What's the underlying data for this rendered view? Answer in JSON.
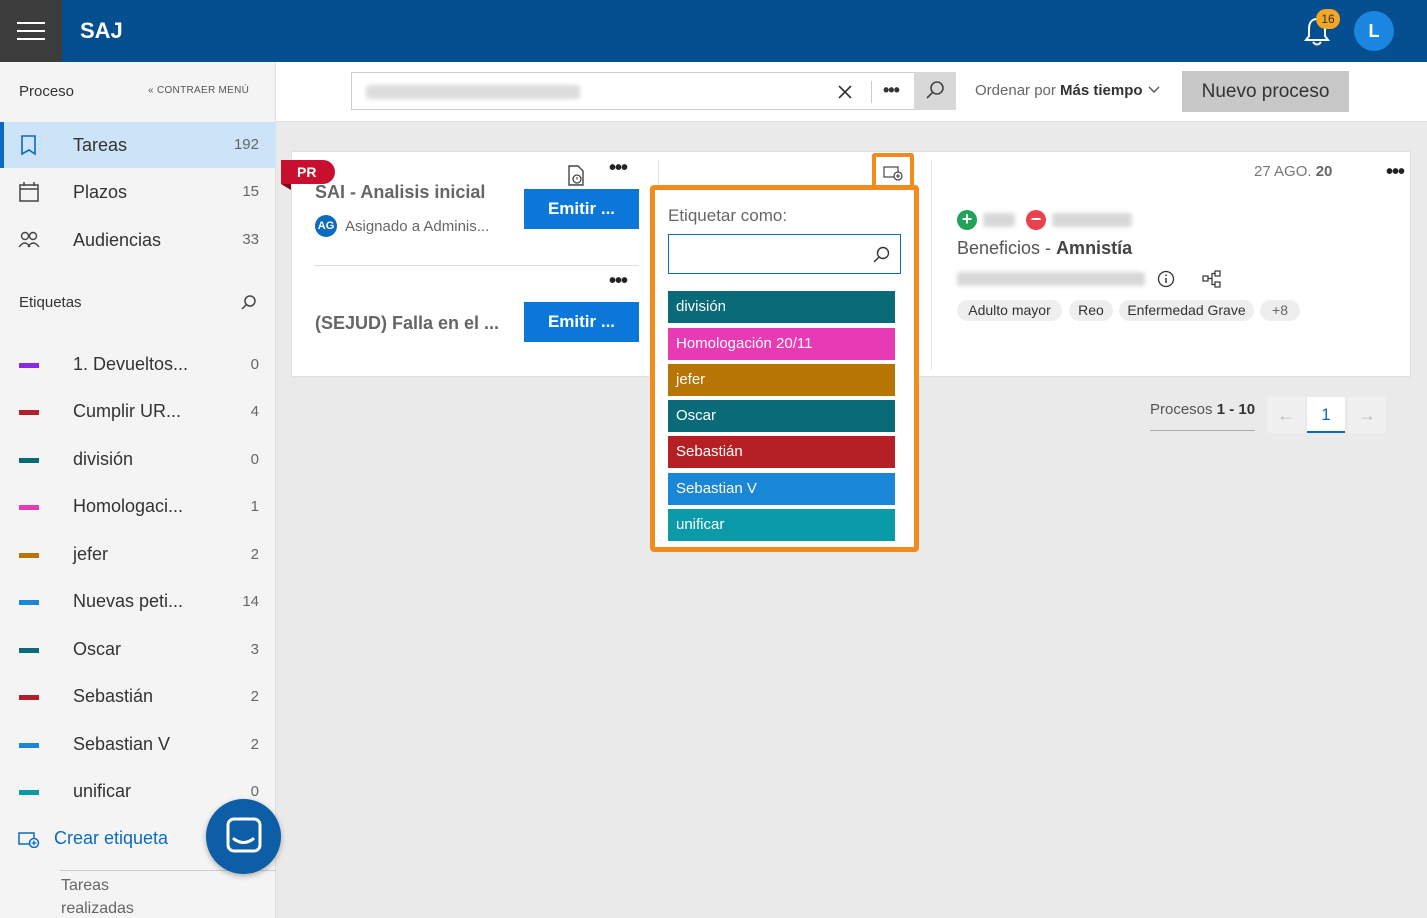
{
  "app": {
    "title": "SAJ",
    "notifications_count": "16",
    "user_initial": "L"
  },
  "sidebar": {
    "section_title": "Proceso",
    "collapse_label": "CONTRAER MENÚ",
    "nav": [
      {
        "label": "Tareas",
        "count": "192",
        "icon": "book-icon"
      },
      {
        "label": "Plazos",
        "count": "15",
        "icon": "calendar-icon"
      },
      {
        "label": "Audiencias",
        "count": "33",
        "icon": "people-icon"
      }
    ],
    "tags_title": "Etiquetas",
    "tags": [
      {
        "label": "1. Devueltos...",
        "count": "0",
        "color": "#8a2be2"
      },
      {
        "label": "Cumplir UR...",
        "count": "4",
        "color": "#b0202a"
      },
      {
        "label": "división",
        "count": "0",
        "color": "#0a6b78"
      },
      {
        "label": "Homologaci...",
        "count": "1",
        "color": "#e83ab5"
      },
      {
        "label": "jefer",
        "count": "2",
        "color": "#b67504"
      },
      {
        "label": "Nuevas peti...",
        "count": "14",
        "color": "#1a86d8"
      },
      {
        "label": "Oscar",
        "count": "3",
        "color": "#0a6b78"
      },
      {
        "label": "Sebastián",
        "count": "2",
        "color": "#b0202a"
      },
      {
        "label": "Sebastian V",
        "count": "2",
        "color": "#1a86d8"
      },
      {
        "label": "unificar",
        "count": "0",
        "color": "#0a9aa8"
      }
    ],
    "create_tag": "Crear etiqueta",
    "done_tasks": "Tareas realizadas"
  },
  "toolbar": {
    "sort_prefix": "Ordenar por",
    "sort_value": "Más tiempo",
    "new_process": "Nuevo proceso"
  },
  "card": {
    "flag": "PR",
    "tasks": [
      {
        "title": "SAI - Analisis inicial",
        "assigned": "Asignado a Adminis...",
        "assignee_initials": "AG",
        "action": "Emitir ..."
      },
      {
        "title": "(SEJUD) Falla en el ...",
        "action": "Emitir ..."
      }
    ],
    "date_prefix": "27 AGO.",
    "date_year": "20",
    "benefit_prefix": "Beneficios -",
    "benefit_value": "Amnistía",
    "chips": [
      "Adulto mayor",
      "Reo",
      "Enfermedad Grave",
      "+8"
    ]
  },
  "popover": {
    "title": "Etiquetar como:",
    "search_placeholder": "",
    "items": [
      {
        "label": "división",
        "color": "#0a6b78"
      },
      {
        "label": "Homologación 20/11",
        "color": "#e83ab5"
      },
      {
        "label": "jefer",
        "color": "#b67504"
      },
      {
        "label": "Oscar",
        "color": "#0a6b78"
      },
      {
        "label": "Sebastián",
        "color": "#b52025"
      },
      {
        "label": "Sebastian V",
        "color": "#1a86d8"
      },
      {
        "label": "unificar",
        "color": "#0a9aa8"
      }
    ]
  },
  "pagination": {
    "label": "Procesos",
    "range": "1 - 10",
    "current": "1"
  }
}
